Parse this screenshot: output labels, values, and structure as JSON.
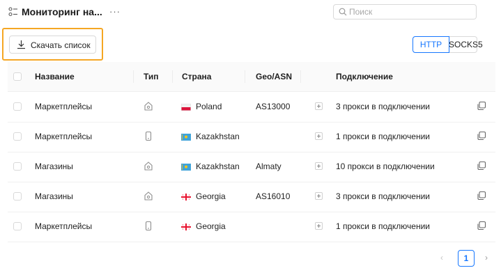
{
  "header": {
    "title": "Мониторинг на...",
    "more_icon": "more-horizontal-icon",
    "search_placeholder": "Поиск",
    "search_value": ""
  },
  "toolbar": {
    "download_label": "Скачать список",
    "protocol_options": [
      "HTTP",
      "SOCKS5"
    ],
    "protocol_selected": "HTTP"
  },
  "colors": {
    "accent": "#1677ff",
    "highlight": "#f5a623"
  },
  "table": {
    "columns": {
      "name": "Название",
      "type": "Тип",
      "country": "Страна",
      "geo": "Geo/ASN",
      "connection": "Подключение"
    },
    "rows": [
      {
        "name": "Маркетплейсы",
        "type_icon": "home-icon",
        "flag": "poland-flag",
        "country": "Poland",
        "geo": "AS13000",
        "connection": "3 прокси в подключении"
      },
      {
        "name": "Маркетплейсы",
        "type_icon": "mobile-icon",
        "flag": "kazakhstan-flag",
        "country": "Kazakhstan",
        "geo": "",
        "connection": "1 прокси в подключении"
      },
      {
        "name": "Магазины",
        "type_icon": "home-icon",
        "flag": "kazakhstan-flag",
        "country": "Kazakhstan",
        "geo": "Almaty",
        "connection": "10 прокси в подключении"
      },
      {
        "name": "Магазины",
        "type_icon": "home-icon",
        "flag": "georgia-flag",
        "country": "Georgia",
        "geo": "AS16010",
        "connection": "3 прокси в подключении"
      },
      {
        "name": "Маркетплейсы",
        "type_icon": "mobile-icon",
        "flag": "georgia-flag",
        "country": "Georgia",
        "geo": "",
        "connection": "1 прокси в подключении"
      }
    ]
  },
  "pagination": {
    "current_page": "1"
  }
}
